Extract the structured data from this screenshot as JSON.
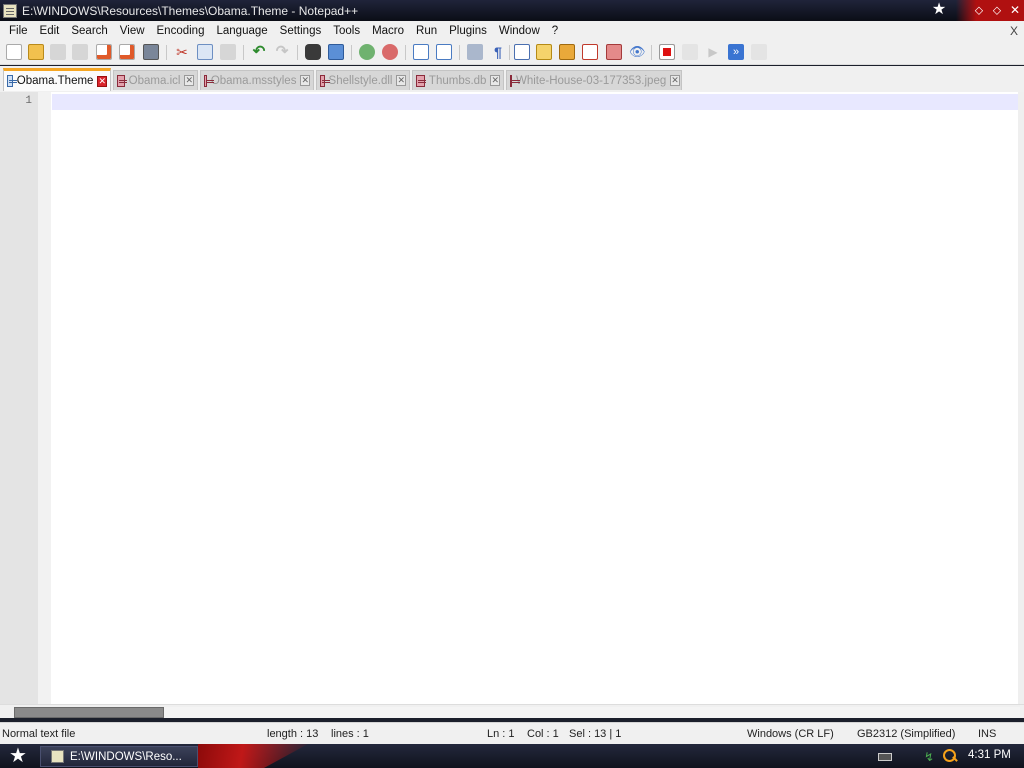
{
  "window": {
    "title": "E:\\WINDOWS\\Resources\\Themes\\Obama.Theme - Notepad++"
  },
  "menu": [
    "File",
    "Edit",
    "Search",
    "View",
    "Encoding",
    "Language",
    "Settings",
    "Tools",
    "Macro",
    "Run",
    "Plugins",
    "Window",
    "?"
  ],
  "menu_close": "X",
  "toolbar_icons": [
    "new-file-icon",
    "open-file-icon",
    "save-icon",
    "save-all-icon",
    "close-icon",
    "close-all-icon",
    "print-icon",
    "cut-icon",
    "copy-icon",
    "paste-icon",
    "undo-icon",
    "redo-icon",
    "find-icon",
    "replace-icon",
    "zoom-in-icon",
    "zoom-out-icon",
    "sync-vertical-icon",
    "sync-horizontal-icon",
    "word-wrap-icon",
    "show-all-chars-icon",
    "indent-guide-icon",
    "language-icon",
    "function-list-icon",
    "folder-workspace-icon",
    "document-map-icon",
    "monitor-icon",
    "record-macro-icon",
    "stop-macro-icon",
    "play-macro-icon",
    "run-macro-multiple-icon",
    "save-macro-icon"
  ],
  "tabs": [
    {
      "label": "Obama.Theme",
      "active": true
    },
    {
      "label": "Obama.icl",
      "active": false
    },
    {
      "label": "Obama.msstyles",
      "active": false
    },
    {
      "label": "Shellstyle.dll",
      "active": false
    },
    {
      "label": "Thumbs.db",
      "active": false
    },
    {
      "label": "White-House-03-177353.jpeg",
      "active": false
    }
  ],
  "editor": {
    "line_number": "1",
    "line_text": ""
  },
  "status": {
    "file_type": "Normal text file",
    "length": "length : 13",
    "lines": "lines : 1",
    "ln": "Ln : 1",
    "col": "Col : 1",
    "sel": "Sel : 13 | 1",
    "eol": "Windows (CR LF)",
    "encoding": "GB2312 (Simplified)",
    "mode": "INS"
  },
  "taskbar": {
    "task_label": "E:\\WINDOWS\\Reso...",
    "clock": "4:31 PM"
  }
}
